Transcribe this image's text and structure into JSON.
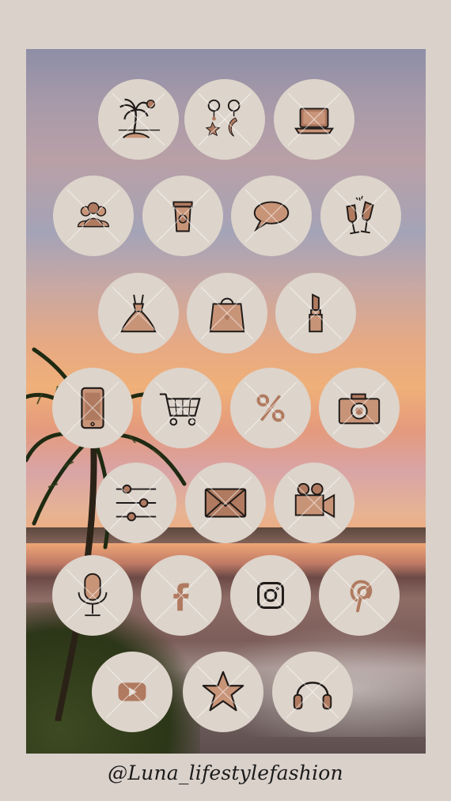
{
  "handle": "@Luna_lifestylefashion",
  "colors": {
    "background": "#d9d1ca",
    "circle": "#ddd4cb",
    "rose_gold": "#b07a60",
    "line": "#1e1a18"
  },
  "highlight_rows": [
    [
      "beach-icon",
      "earrings-icon",
      "laptop-icon"
    ],
    [
      "friends-icon",
      "coffee-cup-icon",
      "speech-bubble-icon",
      "champagne-icon"
    ],
    [
      "dress-icon",
      "shopping-bag-icon",
      "lipstick-icon"
    ],
    [
      "smartphone-icon",
      "shopping-cart-icon",
      "percent-icon",
      "camera-icon"
    ],
    [
      "sliders-icon",
      "envelope-icon",
      "video-camera-icon"
    ],
    [
      "microphone-icon",
      "facebook-icon",
      "instagram-icon",
      "pinterest-icon"
    ],
    [
      "youtube-icon",
      "star-icon",
      "headphones-icon"
    ]
  ]
}
